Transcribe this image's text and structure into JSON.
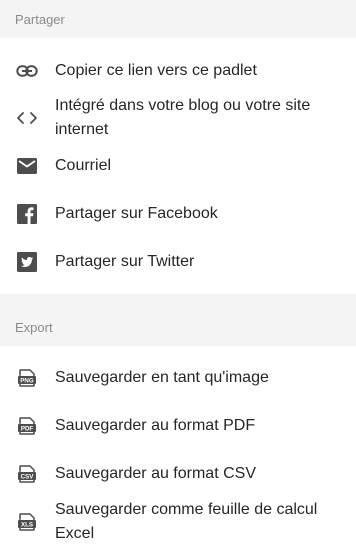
{
  "share": {
    "header": "Partager",
    "items": [
      {
        "label": "Copier ce lien vers ce padlet",
        "icon": "link-icon"
      },
      {
        "label": "Intégré dans votre blog ou votre site internet",
        "icon": "embed-code-icon"
      },
      {
        "label": "Courriel",
        "icon": "email-icon"
      },
      {
        "label": "Partager sur Facebook",
        "icon": "facebook-icon"
      },
      {
        "label": "Partager sur Twitter",
        "icon": "twitter-icon"
      }
    ]
  },
  "export": {
    "header": "Export",
    "items": [
      {
        "label": "Sauvegarder en tant qu'image",
        "icon": "png-file-icon",
        "badge": "PNG"
      },
      {
        "label": "Sauvegarder au format PDF",
        "icon": "pdf-file-icon",
        "badge": "PDF"
      },
      {
        "label": "Sauvegarder au format CSV",
        "icon": "csv-file-icon",
        "badge": "CSV"
      },
      {
        "label": "Sauvegarder comme feuille de calcul Excel",
        "icon": "xls-file-icon",
        "badge": "XLS"
      }
    ]
  },
  "colors": {
    "icon": "#4d4d4d",
    "header_bg": "#f4f4f4",
    "header_text": "#8a8a8a"
  }
}
